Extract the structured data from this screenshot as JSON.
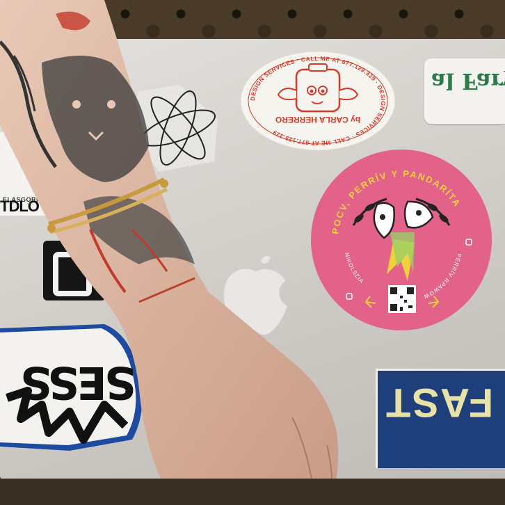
{
  "scene": {
    "oval_sticker": {
      "ring_text": "DESIGN SERVICES · CALL ME AT 677.129.329 · DESIGN SERVICES · CALL ME AT 677.129.329",
      "name_text": "by CARLA HERRERO",
      "colors": {
        "ink": "#d63a2a",
        "paper": "#f6f4ee"
      }
    },
    "pink_sticker": {
      "ring_text_top": "POCV, PERRÍV Y PANDARÍTA",
      "ring_text_left": "NIKOLSZIA",
      "ring_text_right": "PERRÍV RPAWOW",
      "colors": {
        "bg": "#e2628a",
        "ink": "#f1d23a"
      }
    },
    "green_sticker": {
      "text": "al Fary ave"
    },
    "blue_sticker": {
      "text": "FAST"
    },
    "left_white_sticker": {
      "small_text": "ELASGORRAS",
      "big_text": "TDLO"
    },
    "graffiti_sticker": {
      "text": "SESS"
    }
  }
}
